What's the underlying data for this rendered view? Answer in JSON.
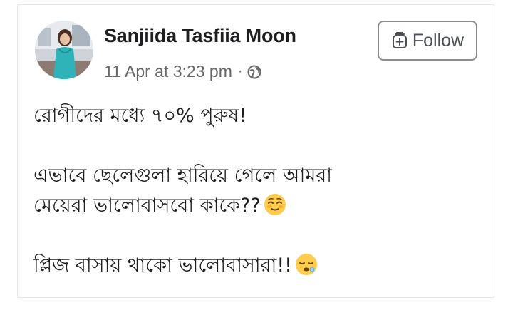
{
  "post": {
    "author_name": "Sanjiida Tasfiia Moon",
    "timestamp": "11 Apr at 3:23 pm",
    "separator": "·",
    "privacy_icon": "globe-icon",
    "follow_label": "Follow",
    "follow_icon": "follow-plus-icon",
    "avatar_icon": "profile-photo",
    "lines": [
      "রোগীদের মধ্যে ৭০% পুরুষ!",
      "এভাবে ছেলেগুলা হারিয়ে গেলে আমরা",
      "মেয়েরা ভালোবাসবো কাকে??",
      "প্লিজ বাসায় থাকো ভালোবাসারা!!"
    ],
    "emojis": [
      "relieved-face-icon",
      "sleepy-face-icon"
    ]
  },
  "colors": {
    "name": "#1c1e21",
    "meta": "#65676b",
    "follow_border": "#8a8d91",
    "emoji_yellow": "#ffcc4d"
  }
}
